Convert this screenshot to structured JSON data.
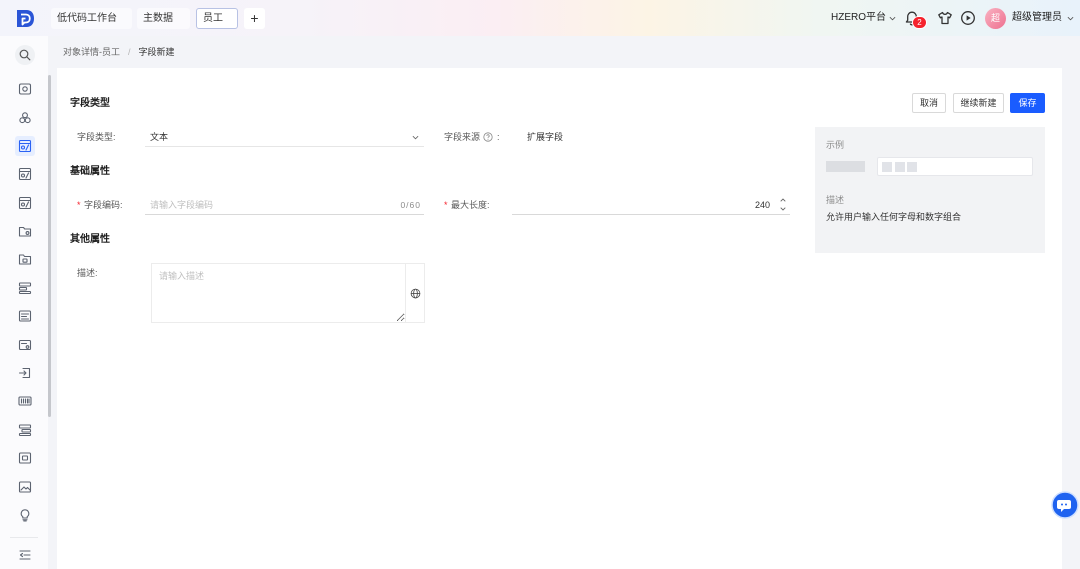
{
  "topbar": {
    "logo_icon": "app-logo-icon",
    "tabs": [
      {
        "label": "低代码工作台",
        "active": false
      },
      {
        "label": "主数据",
        "active": false
      },
      {
        "label": "员工",
        "active": true
      }
    ],
    "add_tab_label": "+",
    "platform_label": "HZERO平台",
    "notification_count": "2",
    "icons": [
      "bell-icon",
      "skin-icon",
      "play-circle-icon",
      "chevron-down-icon"
    ],
    "user": {
      "avatar_text": "超",
      "name": "超级管理员"
    }
  },
  "sidebar": {
    "search_icon": "search-icon",
    "items": [
      {
        "icon": "screen-icon",
        "active": false
      },
      {
        "icon": "cluster-icon",
        "active": false
      },
      {
        "icon": "object-icon",
        "active": true
      },
      {
        "icon": "data-table-icon",
        "active": false
      },
      {
        "icon": "field-table-icon",
        "active": false
      },
      {
        "icon": "folder-settings-icon",
        "active": false
      },
      {
        "icon": "folder-lock-icon",
        "active": false
      },
      {
        "icon": "process-icon",
        "active": false
      },
      {
        "icon": "report-icon",
        "active": false
      },
      {
        "icon": "form-icon",
        "active": false
      },
      {
        "icon": "login-icon",
        "active": false
      },
      {
        "icon": "keyboard-icon",
        "active": false
      },
      {
        "icon": "hierarchy-icon",
        "active": false
      },
      {
        "icon": "card-icon",
        "active": false
      },
      {
        "icon": "image-icon",
        "active": false
      },
      {
        "icon": "bulb-icon",
        "active": false
      }
    ],
    "collapse_icon": "menu-fold-icon"
  },
  "breadcrumb": {
    "items": [
      "对象详情-员工",
      "字段新建"
    ],
    "separator": "/"
  },
  "toolbar": {
    "cancel_label": "取消",
    "continue_label": "继续新建",
    "save_label": "保存"
  },
  "sections": {
    "field_type": "字段类型",
    "basic": "基础属性",
    "other": "其他属性"
  },
  "form": {
    "required_mark": "*",
    "field_type": {
      "label": "字段类型:",
      "value": "文本"
    },
    "field_source": {
      "label": "字段来源",
      "colon": ":",
      "value": "扩展字段",
      "help_icon": "question-circle-icon"
    },
    "field_code": {
      "label": "字段编码:",
      "placeholder": "请输入字段编码",
      "counter": "0/60"
    },
    "max_length": {
      "label": "最大长度:",
      "value": "240"
    },
    "description": {
      "label": "描述:",
      "placeholder": "请输入描述",
      "i18n_icon": "globe-icon"
    }
  },
  "preview": {
    "title": "示例",
    "desc_title": "描述",
    "desc_text": "允许用户输入任何字母和数字组合"
  },
  "floating_button_icon": "customer-service-icon",
  "colors": {
    "accent": "#1a5cff",
    "badge": "#f5222d",
    "required": "#f5222d",
    "sidebar_active": "#2a62f4"
  }
}
